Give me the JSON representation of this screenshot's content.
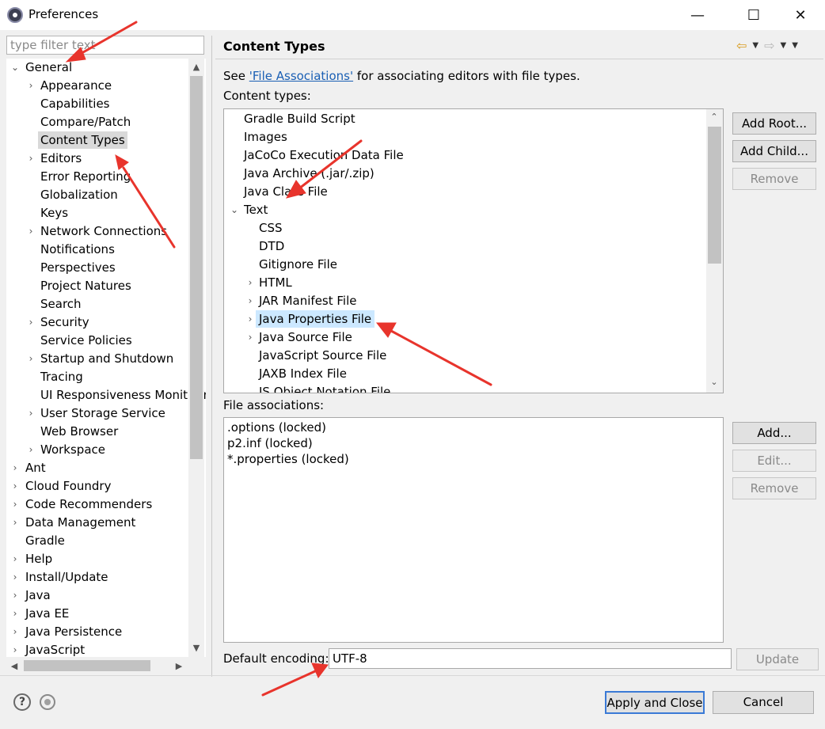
{
  "window": {
    "title": "Preferences",
    "minimize_glyph": "—",
    "maximize_glyph": "☐",
    "close_glyph": "✕"
  },
  "filter": {
    "placeholder": "type filter text"
  },
  "tree": {
    "general": "General",
    "general_children": [
      "Appearance",
      "Capabilities",
      "Compare/Patch",
      "Content Types",
      "Editors",
      "Error Reporting",
      "Globalization",
      "Keys",
      "Network Connections",
      "Notifications",
      "Perspectives",
      "Project Natures",
      "Search",
      "Security",
      "Service Policies",
      "Startup and Shutdown",
      "Tracing",
      "UI Responsiveness Monitoring",
      "User Storage Service",
      "Web Browser",
      "Workspace"
    ],
    "top_items": [
      "Ant",
      "Cloud Foundry",
      "Code Recommenders",
      "Data Management",
      "Gradle",
      "Help",
      "Install/Update",
      "Java",
      "Java EE",
      "Java Persistence",
      "JavaScript"
    ]
  },
  "page": {
    "title": "Content Types",
    "see_prefix": "See ",
    "see_link": "'File Associations'",
    "see_suffix": " for associating editors with file types.",
    "content_types_label": "Content types:",
    "file_assoc_label": "File associations:",
    "encoding_label": "Default encoding:",
    "encoding_value": "UTF-8"
  },
  "content_types": {
    "top": [
      "Gradle Build Script",
      "Images",
      "JaCoCo Execution Data File",
      "Java Archive (.jar/.zip)",
      "Java Class File"
    ],
    "text": "Text",
    "text_children": [
      "CSS",
      "DTD",
      "Gitignore File",
      "HTML",
      "JAR Manifest File",
      "Java Properties File",
      "Java Source File",
      "JavaScript Source File",
      "JAXB Index File",
      "JS Object Notation File"
    ]
  },
  "file_associations": [
    ".options (locked)",
    "p2.inf (locked)",
    "*.properties (locked)"
  ],
  "buttons": {
    "add_root": "Add Root...",
    "add_child": "Add Child...",
    "remove": "Remove",
    "add": "Add...",
    "edit": "Edit...",
    "remove2": "Remove",
    "update": "Update",
    "apply_close": "Apply and Close",
    "cancel": "Cancel",
    "help": "?"
  },
  "colors": {
    "annotation_arrow": "#e8342c",
    "link": "#1a5fb4",
    "selection": "#cce8ff"
  }
}
